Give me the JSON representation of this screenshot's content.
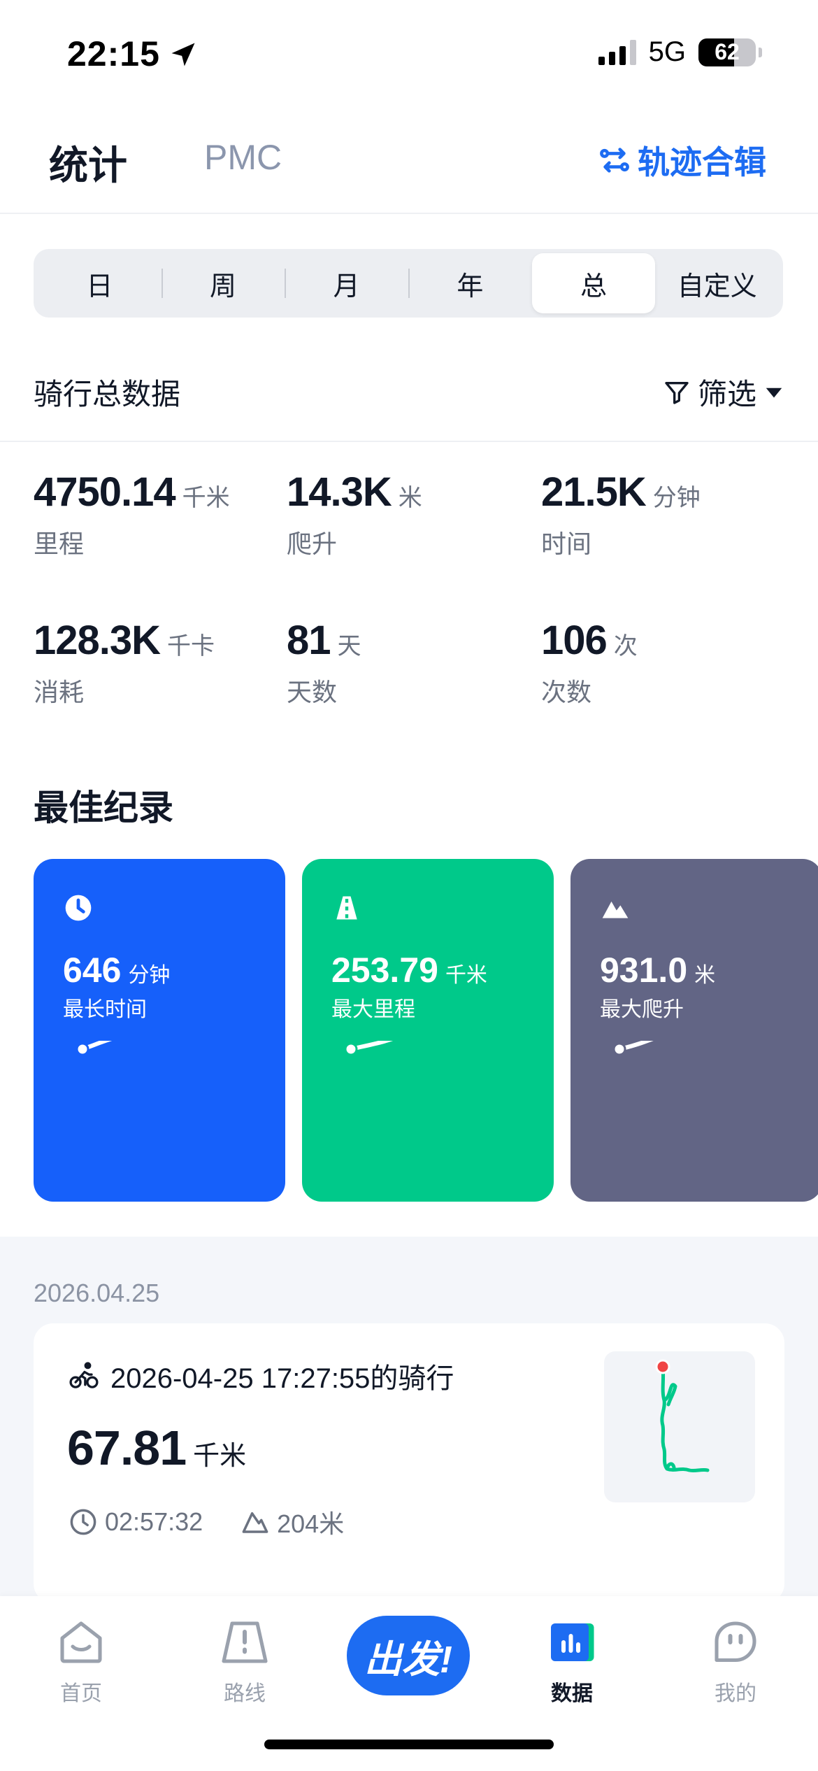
{
  "status": {
    "time": "22:15",
    "network": "5G",
    "battery": "62",
    "battery_level": 0.62
  },
  "header": {
    "tab_stats": "统计",
    "tab_pmc": "PMC",
    "track_link": "轨迹合辑"
  },
  "segments": [
    {
      "label": "日",
      "active": false
    },
    {
      "label": "周",
      "active": false
    },
    {
      "label": "月",
      "active": false
    },
    {
      "label": "年",
      "active": false
    },
    {
      "label": "总",
      "active": true
    },
    {
      "label": "自定义",
      "active": false
    }
  ],
  "summary": {
    "title": "骑行总数据",
    "filter_label": "筛选"
  },
  "stats": [
    {
      "value": "4750.14",
      "unit": "千米",
      "label": "里程"
    },
    {
      "value": "14.3K",
      "unit": "米",
      "label": "爬升"
    },
    {
      "value": "21.5K",
      "unit": "分钟",
      "label": "时间"
    },
    {
      "value": "128.3K",
      "unit": "千卡",
      "label": "消耗"
    },
    {
      "value": "81",
      "unit": "天",
      "label": "天数"
    },
    {
      "value": "106",
      "unit": "次",
      "label": "次数"
    }
  ],
  "best": {
    "title": "最佳纪录",
    "cards": [
      {
        "value": "646",
        "unit": "分钟",
        "label": "最长时间",
        "color": "#1660fa",
        "icon": "clock-icon"
      },
      {
        "value": "253.79",
        "unit": "千米",
        "label": "最大里程",
        "color": "#00c98a",
        "icon": "road-icon"
      },
      {
        "value": "931.0",
        "unit": "米",
        "label": "最大爬升",
        "color": "#626585",
        "icon": "mountain-icon"
      }
    ]
  },
  "activity": {
    "date": "2026.04.25",
    "title": "2026-04-25 17:27:55的骑行",
    "distance": "67.81",
    "distance_unit": "千米",
    "duration": "02:57:32",
    "elevation": "204米"
  },
  "tabbar": {
    "home": "首页",
    "route": "路线",
    "go": "出发!",
    "data": "数据",
    "mine": "我的"
  },
  "colors": {
    "accent": "#1d6cf2",
    "route_line": "#00c98a",
    "route_start": "#f04444"
  }
}
